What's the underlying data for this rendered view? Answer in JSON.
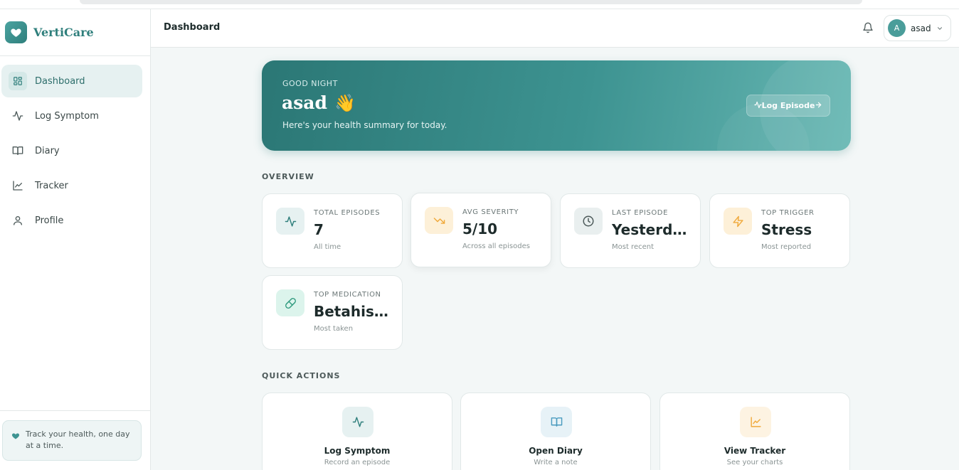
{
  "app": {
    "name": "VertiCare"
  },
  "sidebar": {
    "items": [
      {
        "label": "Dashboard",
        "icon": "grid-icon",
        "active": true
      },
      {
        "label": "Log Symptom",
        "icon": "activity-icon",
        "active": false
      },
      {
        "label": "Diary",
        "icon": "book-icon",
        "active": false
      },
      {
        "label": "Tracker",
        "icon": "line-chart-icon",
        "active": false
      },
      {
        "label": "Profile",
        "icon": "user-icon",
        "active": false
      }
    ],
    "footer_tip": "Track your health, one day at a time."
  },
  "header": {
    "title": "Dashboard",
    "user": {
      "initial": "A",
      "name": "asad"
    }
  },
  "hero": {
    "greeting": "GOOD NIGHT",
    "name": "asad",
    "emoji": "👋",
    "subtitle": "Here's your health summary for today.",
    "button_label": "Log Episode"
  },
  "overview": {
    "label": "OVERVIEW",
    "cards": [
      {
        "label": "TOTAL EPISODES",
        "value": "7",
        "sub": "All time",
        "icon": "activity-icon"
      },
      {
        "label": "AVG SEVERITY",
        "value": "5/10",
        "sub": "Across all episodes",
        "icon": "trending-down-icon"
      },
      {
        "label": "LAST EPISODE",
        "value": "Yesterday",
        "sub": "Most recent",
        "icon": "clock-icon"
      },
      {
        "label": "TOP TRIGGER",
        "value": "Stress",
        "sub": "Most reported",
        "icon": "lightning-icon"
      },
      {
        "label": "TOP MEDICATION",
        "value": "Betahistine",
        "sub": "Most taken",
        "icon": "pill-icon"
      }
    ]
  },
  "quick_actions": {
    "label": "QUICK ACTIONS",
    "items": [
      {
        "title": "Log Symptom",
        "sub": "Record an episode",
        "icon": "activity-icon"
      },
      {
        "title": "Open Diary",
        "sub": "Write a note",
        "icon": "book-icon"
      },
      {
        "title": "View Tracker",
        "sub": "See your charts",
        "icon": "line-chart-icon"
      }
    ]
  },
  "colors": {
    "brand": "#2f7f7c",
    "accent_teal": "#3d9391",
    "amber": "#f0a93b",
    "green": "#3db89a"
  }
}
